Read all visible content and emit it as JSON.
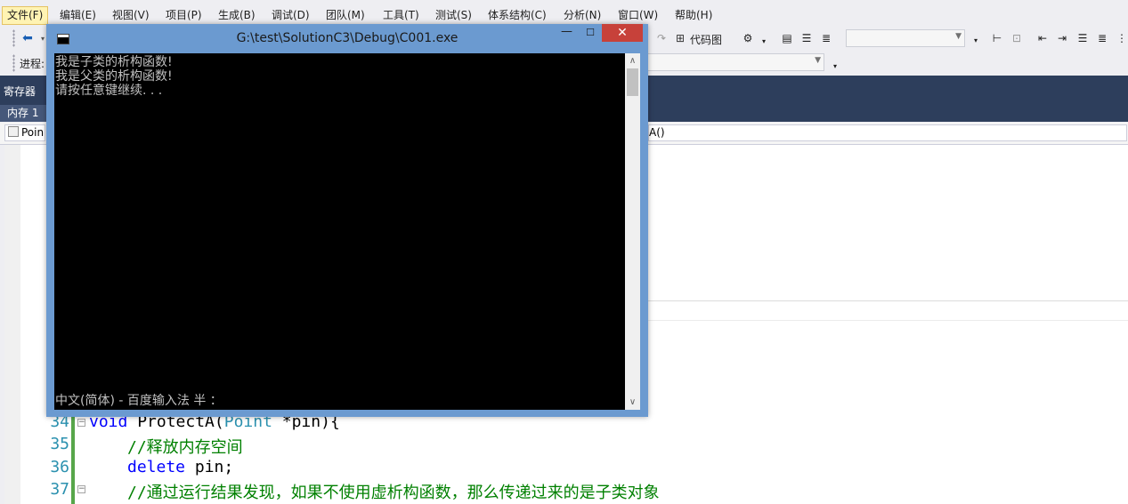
{
  "menu": {
    "items": [
      "文件(F)",
      "编辑(E)",
      "视图(V)",
      "项目(P)",
      "生成(B)",
      "调试(D)",
      "团队(M)",
      "工具(T)",
      "测试(S)",
      "体系结构(C)",
      "分析(N)",
      "窗口(W)",
      "帮助(H)"
    ]
  },
  "toolbar": {
    "codemap_label": "代码图",
    "progress_label": "进程:"
  },
  "panels": {
    "registers_tab": "寄存器",
    "memory_tab": "内存 1"
  },
  "navbar": {
    "left_value": "Poin",
    "right_value": "A()"
  },
  "editor": {
    "lines": [
      {
        "number": "34",
        "keyword": "void",
        "text": " ProtectA(",
        "type": "Point",
        "rest": " *pin){"
      },
      {
        "number": "35",
        "comment": "//释放内存空间"
      },
      {
        "number": "36",
        "keyword": "delete",
        "text": " pin;"
      },
      {
        "number": "37",
        "comment": "//通过运行结果发现，如果不使用虚析构函数，那么传递过来的是子类对象"
      }
    ]
  },
  "console": {
    "title": "G:\\test\\SolutionC3\\Debug\\C001.exe",
    "output": [
      "我是子类的析构函数!",
      "我是父类的析构函数!",
      "请按任意键继续. . ."
    ],
    "ime_status": "中文(简体) - 百度输入法 半 ："
  }
}
